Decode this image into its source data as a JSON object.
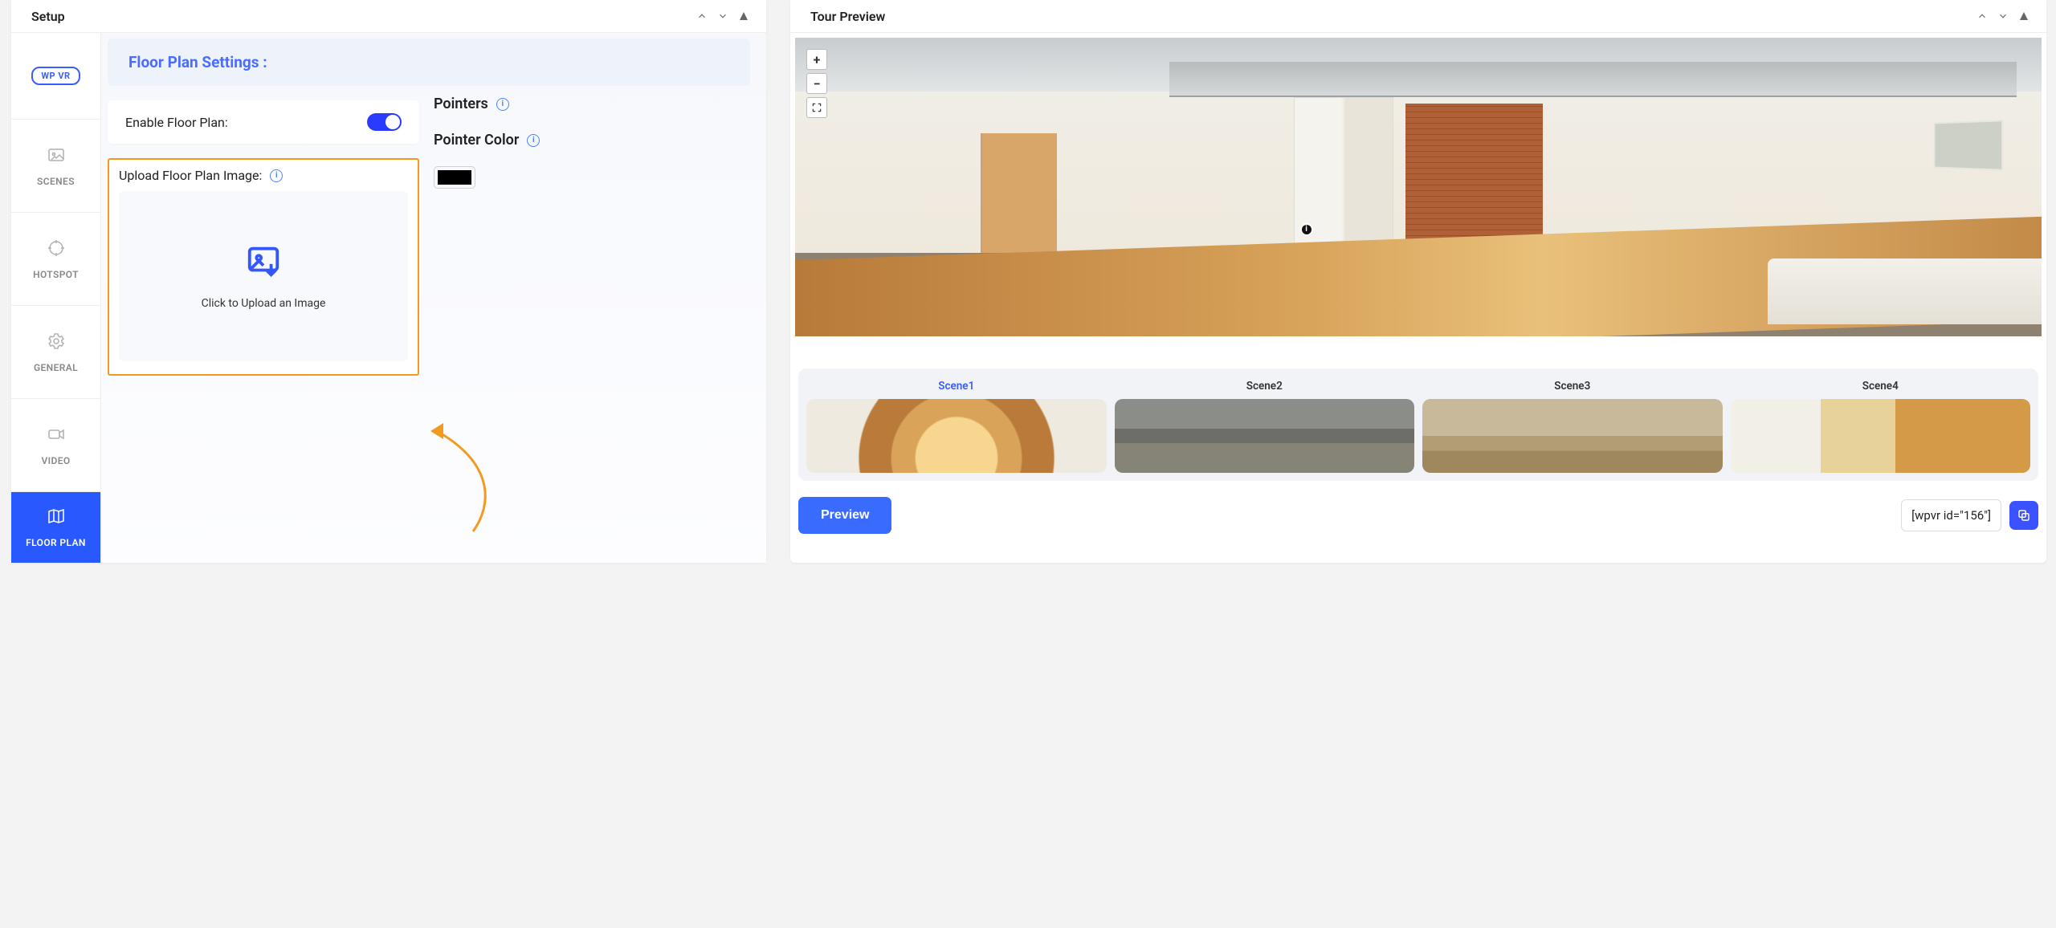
{
  "setup": {
    "title": "Setup",
    "logo_text": "WP VR",
    "nav": {
      "scenes": "SCENES",
      "hotspot": "HOTSPOT",
      "general": "GENERAL",
      "video": "VIDEO",
      "floor_plan": "FLOOR PLAN"
    }
  },
  "floor_plan": {
    "heading": "Floor Plan Settings :",
    "enable_label": "Enable Floor Plan:",
    "enable_value": true,
    "upload_label": "Upload Floor Plan Image:",
    "upload_hint": "Click to Upload an Image",
    "pointers_heading": "Pointers",
    "pointer_color_label": "Pointer Color",
    "pointer_color_value": "#000000"
  },
  "tour_preview": {
    "title": "Tour Preview",
    "zoom_in": "+",
    "zoom_out": "−",
    "hotspot_icon": "i",
    "scenes": [
      "Scene1",
      "Scene2",
      "Scene3",
      "Scene4"
    ],
    "active_scene_index": 0,
    "preview_button": "Preview",
    "shortcode": "[wpvr id=\"156\"]"
  }
}
